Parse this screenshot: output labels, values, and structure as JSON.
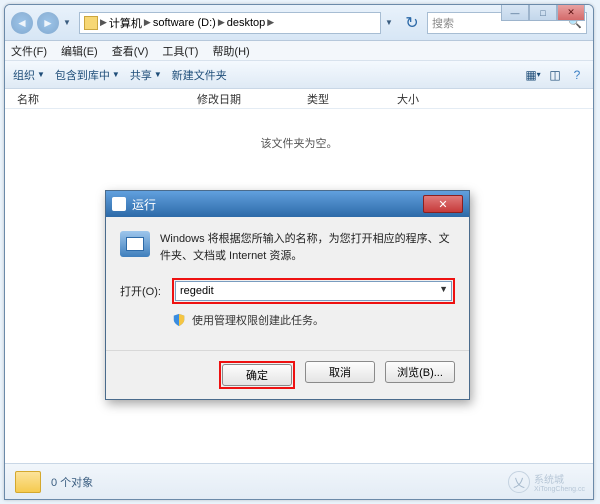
{
  "window_controls": {
    "min": "—",
    "max": "□",
    "close": "✕"
  },
  "breadcrumb": {
    "seg1": "计算机",
    "seg2": "software (D:)",
    "seg3": "desktop"
  },
  "search": {
    "placeholder": "搜索"
  },
  "menubar": {
    "file": "文件(F)",
    "edit": "编辑(E)",
    "view": "查看(V)",
    "tools": "工具(T)",
    "help": "帮助(H)"
  },
  "toolbar": {
    "organize": "组织",
    "include": "包含到库中",
    "share": "共享",
    "new_folder": "新建文件夹"
  },
  "columns": {
    "name": "名称",
    "date": "修改日期",
    "type": "类型",
    "size": "大小"
  },
  "content": {
    "empty_text": "该文件夹为空。"
  },
  "statusbar": {
    "text": "0 个对象"
  },
  "watermark": {
    "text": "系统城",
    "sub": "XiTongCheng.cc"
  },
  "run_dialog": {
    "title": "运行",
    "desc": "Windows 将根据您所输入的名称，为您打开相应的程序、文件夹、文档或 Internet 资源。",
    "label": "打开(O):",
    "value": "regedit",
    "shield_text": "使用管理权限创建此任务。",
    "ok": "确定",
    "cancel": "取消",
    "browse": "浏览(B)..."
  }
}
